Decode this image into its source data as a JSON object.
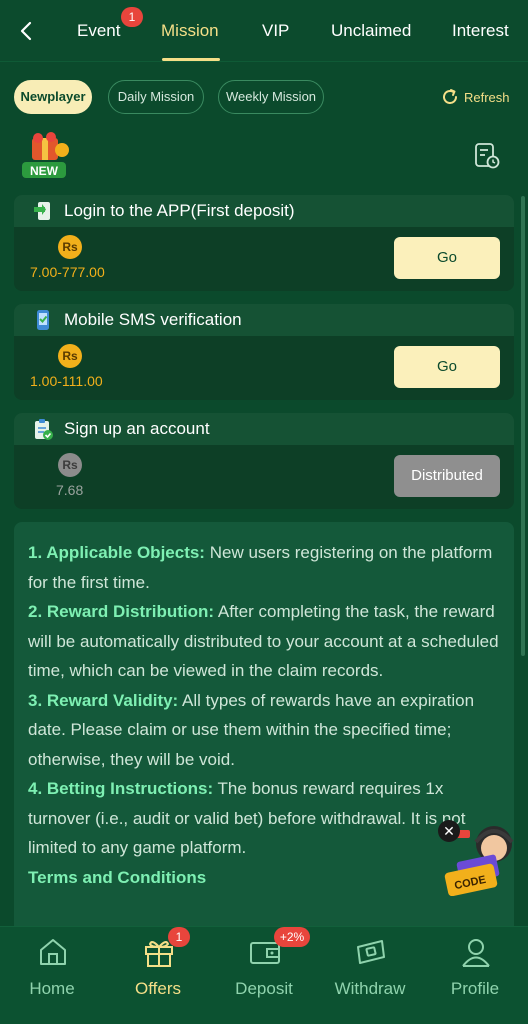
{
  "tabs": [
    {
      "label": "Event",
      "badge": "1"
    },
    {
      "label": "Mission"
    },
    {
      "label": "VIP"
    },
    {
      "label": "Unclaimed"
    },
    {
      "label": "Interest"
    }
  ],
  "active_tab": "Mission",
  "filters": [
    "Newplayer",
    "Daily Mission",
    "Weekly Mission"
  ],
  "active_filter": "Newplayer",
  "refresh_label": "Refresh",
  "new_badge_text": "NEW",
  "currency_symbol": "Rs",
  "tasks": [
    {
      "title": "Login to the APP(First deposit)",
      "amount": "7.00-777.00",
      "button": "Go",
      "status": "available"
    },
    {
      "title": "Mobile SMS verification",
      "amount": "1.00-111.00",
      "button": "Go",
      "status": "available"
    },
    {
      "title": "Sign up an account",
      "amount": "7.68",
      "button": "Distributed",
      "status": "distributed"
    }
  ],
  "rules": [
    {
      "heading": "1. Applicable Objects:",
      "text": "New users registering on the platform for the first time."
    },
    {
      "heading": "2. Reward Distribution:",
      "text": "After completing the task, the reward will be automatically distributed to your account at a scheduled time, which can be viewed in the claim records."
    },
    {
      "heading": "3. Reward Validity:",
      "text": "All types of rewards have an expiration date. Please claim or use them within the specified time; otherwise, they will be void."
    },
    {
      "heading": "4. Betting Instructions:",
      "text": "The bonus reward requires 1x turnover (i.e., audit or valid bet) before withdrawal. It is not limited to any game platform."
    }
  ],
  "terms_label": "Terms and Conditions",
  "promo": {
    "close": "✕",
    "label": "CODE"
  },
  "nav": [
    {
      "label": "Home",
      "icon": "home-icon"
    },
    {
      "label": "Offers",
      "icon": "gift-icon",
      "badge": "1"
    },
    {
      "label": "Deposit",
      "icon": "wallet-icon",
      "badge": "+2%"
    },
    {
      "label": "Withdraw",
      "icon": "withdraw-icon"
    },
    {
      "label": "Profile",
      "icon": "profile-icon"
    }
  ],
  "active_nav": "Offers",
  "colors": {
    "background": "#0b4a2c",
    "accent": "#f5df88",
    "highlight": "#7ef0b3",
    "coin": "#f2b01b",
    "badge": "#e8453c"
  }
}
